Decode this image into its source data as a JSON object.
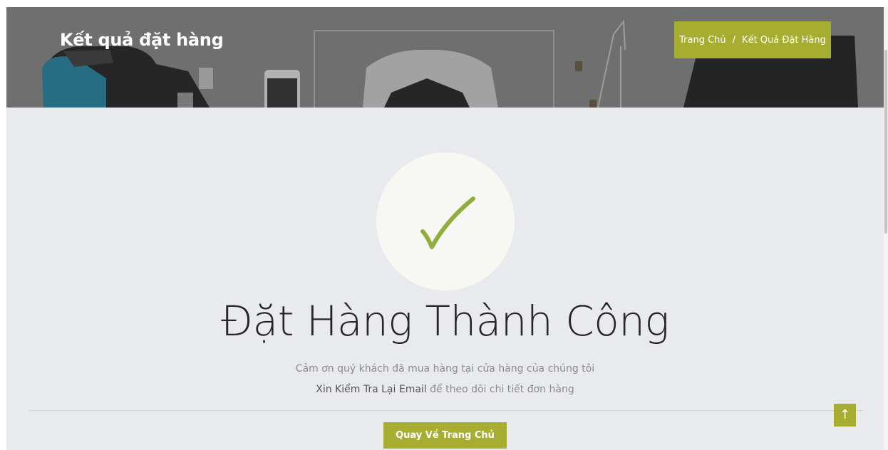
{
  "hero": {
    "title": "Kết quả đặt hàng",
    "breadcrumb": {
      "home": "Trang Chủ",
      "separator": "/",
      "current": "Kết Quả Đặt Hàng"
    }
  },
  "result": {
    "icon": "check-icon",
    "headline": "Đặt Hàng Thành Công",
    "thanks_line": "Cảm ơn quý khách đã mua hàng tại cửa hàng của chúng tôi",
    "email_emphasis": "Xin Kiểm Tra Lại Email",
    "email_rest": " để theo dõi chi tiết đơn hàng",
    "back_button": "Quay Về Trang Chủ"
  },
  "scroll_top": {
    "icon": "arrow-up-icon",
    "glyph": "↑"
  },
  "colors": {
    "accent": "#a7ad30",
    "check": "#8fae3e",
    "page_bg": "#e8eaed",
    "circle_bg": "#f7f8f4",
    "headline": "#262626"
  }
}
